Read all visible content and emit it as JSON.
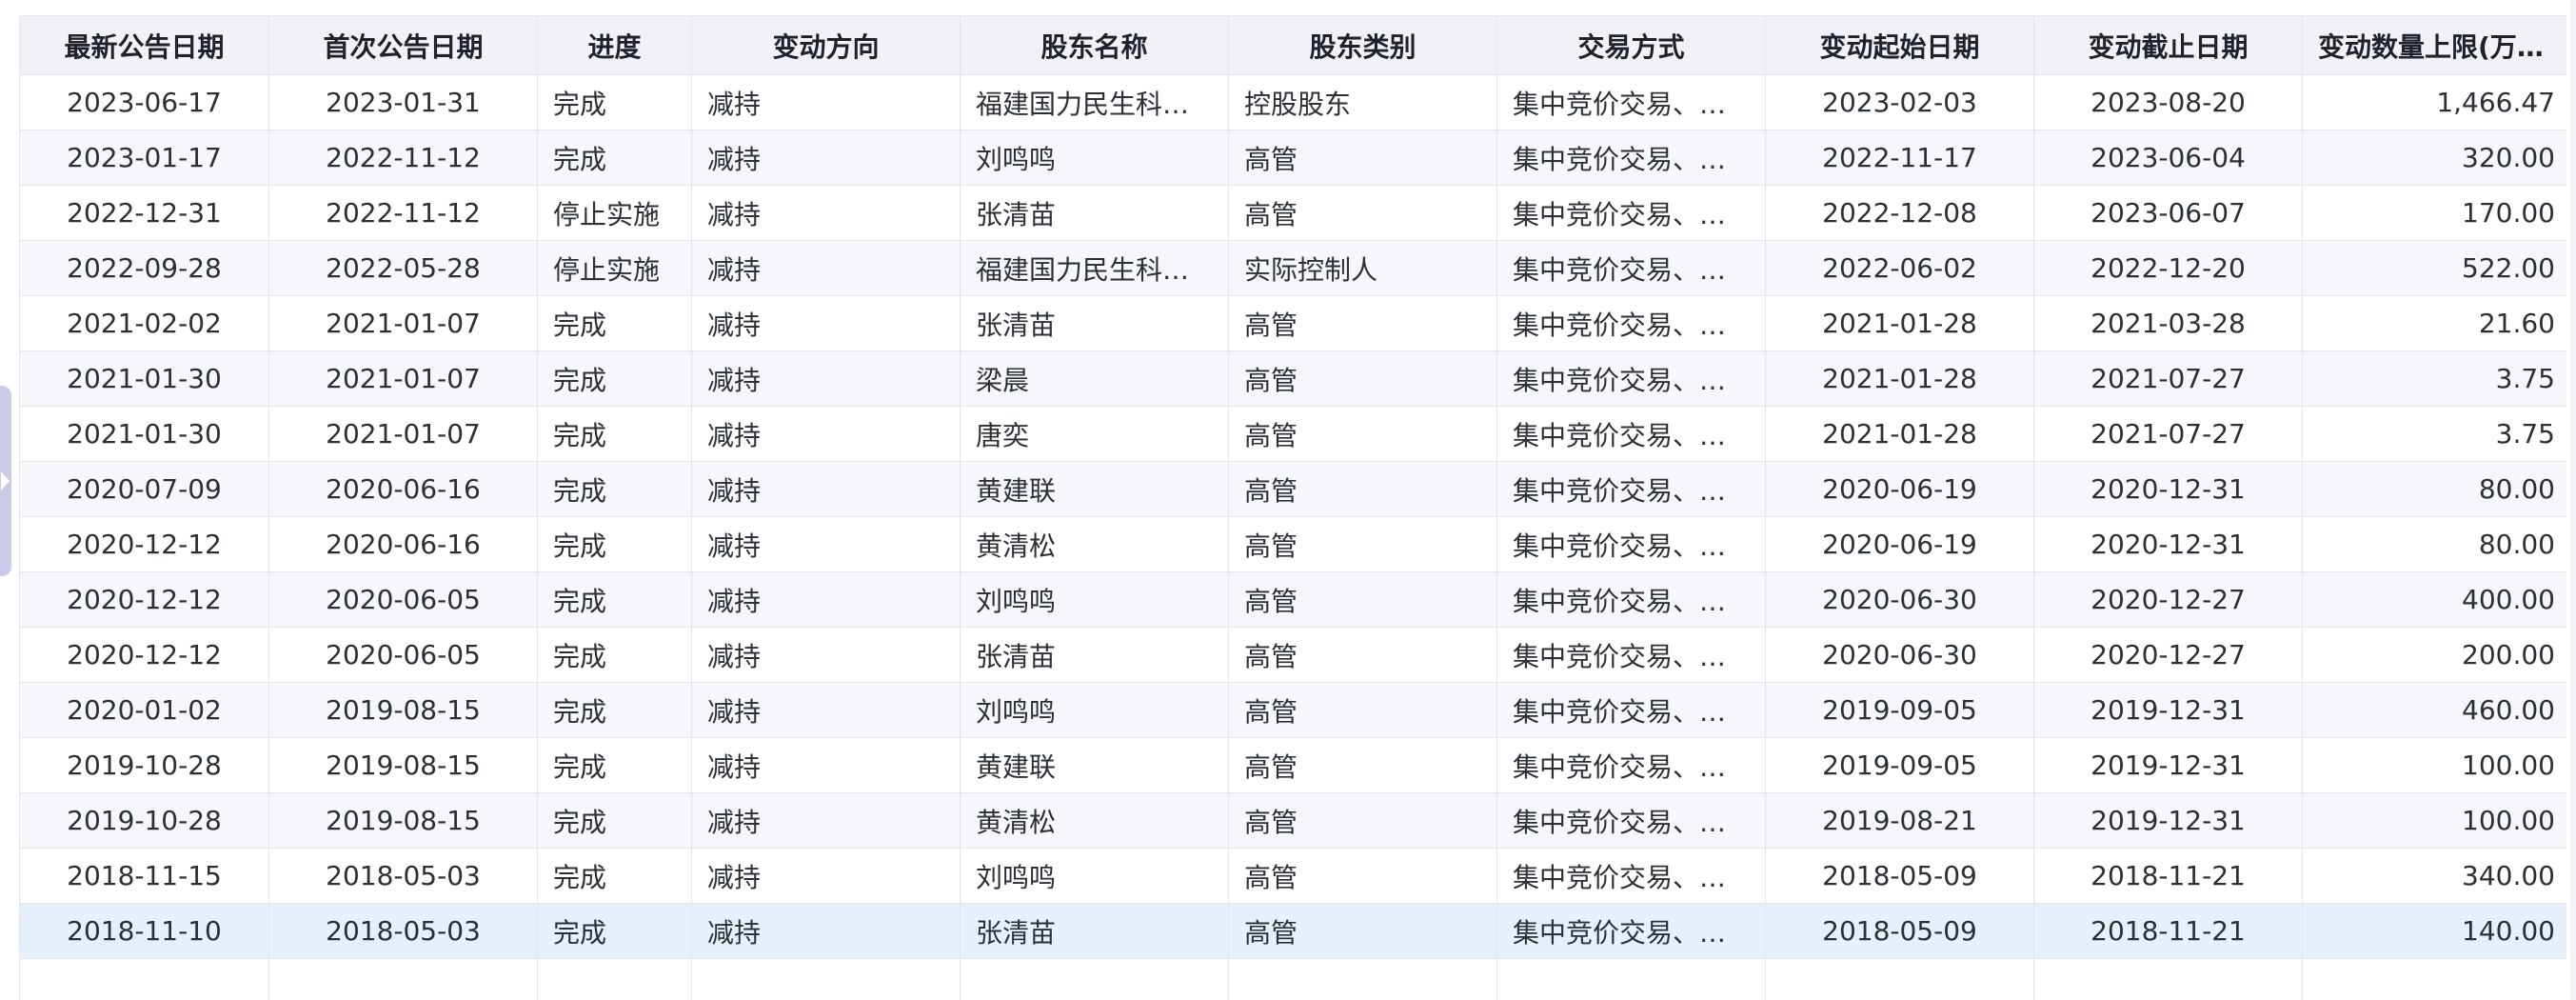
{
  "table": {
    "headers": [
      "最新公告日期",
      "首次公告日期",
      "进度",
      "变动方向",
      "股东名称",
      "股东类别",
      "交易方式",
      "变动起始日期",
      "变动截止日期",
      "变动数量上限(万股)"
    ],
    "rows": [
      [
        "2023-06-17",
        "2023-01-31",
        "完成",
        "减持",
        "福建国力民生科技…",
        "控股股东",
        "集中竞价交易、大…",
        "2023-02-03",
        "2023-08-20",
        "1,466.47"
      ],
      [
        "2023-01-17",
        "2022-11-12",
        "完成",
        "减持",
        "刘鸣鸣",
        "高管",
        "集中竞价交易、大…",
        "2022-11-17",
        "2023-06-04",
        "320.00"
      ],
      [
        "2022-12-31",
        "2022-11-12",
        "停止实施",
        "减持",
        "张清苗",
        "高管",
        "集中竞价交易、大…",
        "2022-12-08",
        "2023-06-07",
        "170.00"
      ],
      [
        "2022-09-28",
        "2022-05-28",
        "停止实施",
        "减持",
        "福建国力民生科技…",
        "实际控制人",
        "集中竞价交易、大…",
        "2022-06-02",
        "2022-12-20",
        "522.00"
      ],
      [
        "2021-02-02",
        "2021-01-07",
        "完成",
        "减持",
        "张清苗",
        "高管",
        "集中竞价交易、大…",
        "2021-01-28",
        "2021-03-28",
        "21.60"
      ],
      [
        "2021-01-30",
        "2021-01-07",
        "完成",
        "减持",
        "梁晨",
        "高管",
        "集中竞价交易、大…",
        "2021-01-28",
        "2021-07-27",
        "3.75"
      ],
      [
        "2021-01-30",
        "2021-01-07",
        "完成",
        "减持",
        "唐奕",
        "高管",
        "集中竞价交易、大…",
        "2021-01-28",
        "2021-07-27",
        "3.75"
      ],
      [
        "2020-07-09",
        "2020-06-16",
        "完成",
        "减持",
        "黄建联",
        "高管",
        "集中竞价交易、大…",
        "2020-06-19",
        "2020-12-31",
        "80.00"
      ],
      [
        "2020-12-12",
        "2020-06-16",
        "完成",
        "减持",
        "黄清松",
        "高管",
        "集中竞价交易、大…",
        "2020-06-19",
        "2020-12-31",
        "80.00"
      ],
      [
        "2020-12-12",
        "2020-06-05",
        "完成",
        "减持",
        "刘鸣鸣",
        "高管",
        "集中竞价交易、大…",
        "2020-06-30",
        "2020-12-27",
        "400.00"
      ],
      [
        "2020-12-12",
        "2020-06-05",
        "完成",
        "减持",
        "张清苗",
        "高管",
        "集中竞价交易、大…",
        "2020-06-30",
        "2020-12-27",
        "200.00"
      ],
      [
        "2020-01-02",
        "2019-08-15",
        "完成",
        "减持",
        "刘鸣鸣",
        "高管",
        "集中竞价交易、大…",
        "2019-09-05",
        "2019-12-31",
        "460.00"
      ],
      [
        "2019-10-28",
        "2019-08-15",
        "完成",
        "减持",
        "黄建联",
        "高管",
        "集中竞价交易、大…",
        "2019-09-05",
        "2019-12-31",
        "100.00"
      ],
      [
        "2019-10-28",
        "2019-08-15",
        "完成",
        "减持",
        "黄清松",
        "高管",
        "集中竞价交易、大…",
        "2019-08-21",
        "2019-12-31",
        "100.00"
      ],
      [
        "2018-11-15",
        "2018-05-03",
        "完成",
        "减持",
        "刘鸣鸣",
        "高管",
        "集中竞价交易、大…",
        "2018-05-09",
        "2018-11-21",
        "340.00"
      ],
      [
        "2018-11-10",
        "2018-05-03",
        "完成",
        "减持",
        "张清苗",
        "高管",
        "集中竞价交易、大…",
        "2018-05-09",
        "2018-11-21",
        "140.00"
      ],
      [
        "",
        "",
        "",
        "",
        "",
        "",
        "",
        "",
        "",
        ""
      ]
    ]
  },
  "colors": {
    "direction_text": "#0e9e55",
    "header_bg": "#f0f2f8",
    "stripe_bg": "#f6f7fb",
    "selected_bg": "#e6f0fd",
    "side_tab": "#c9cbe8"
  },
  "selected_row_index": 15
}
